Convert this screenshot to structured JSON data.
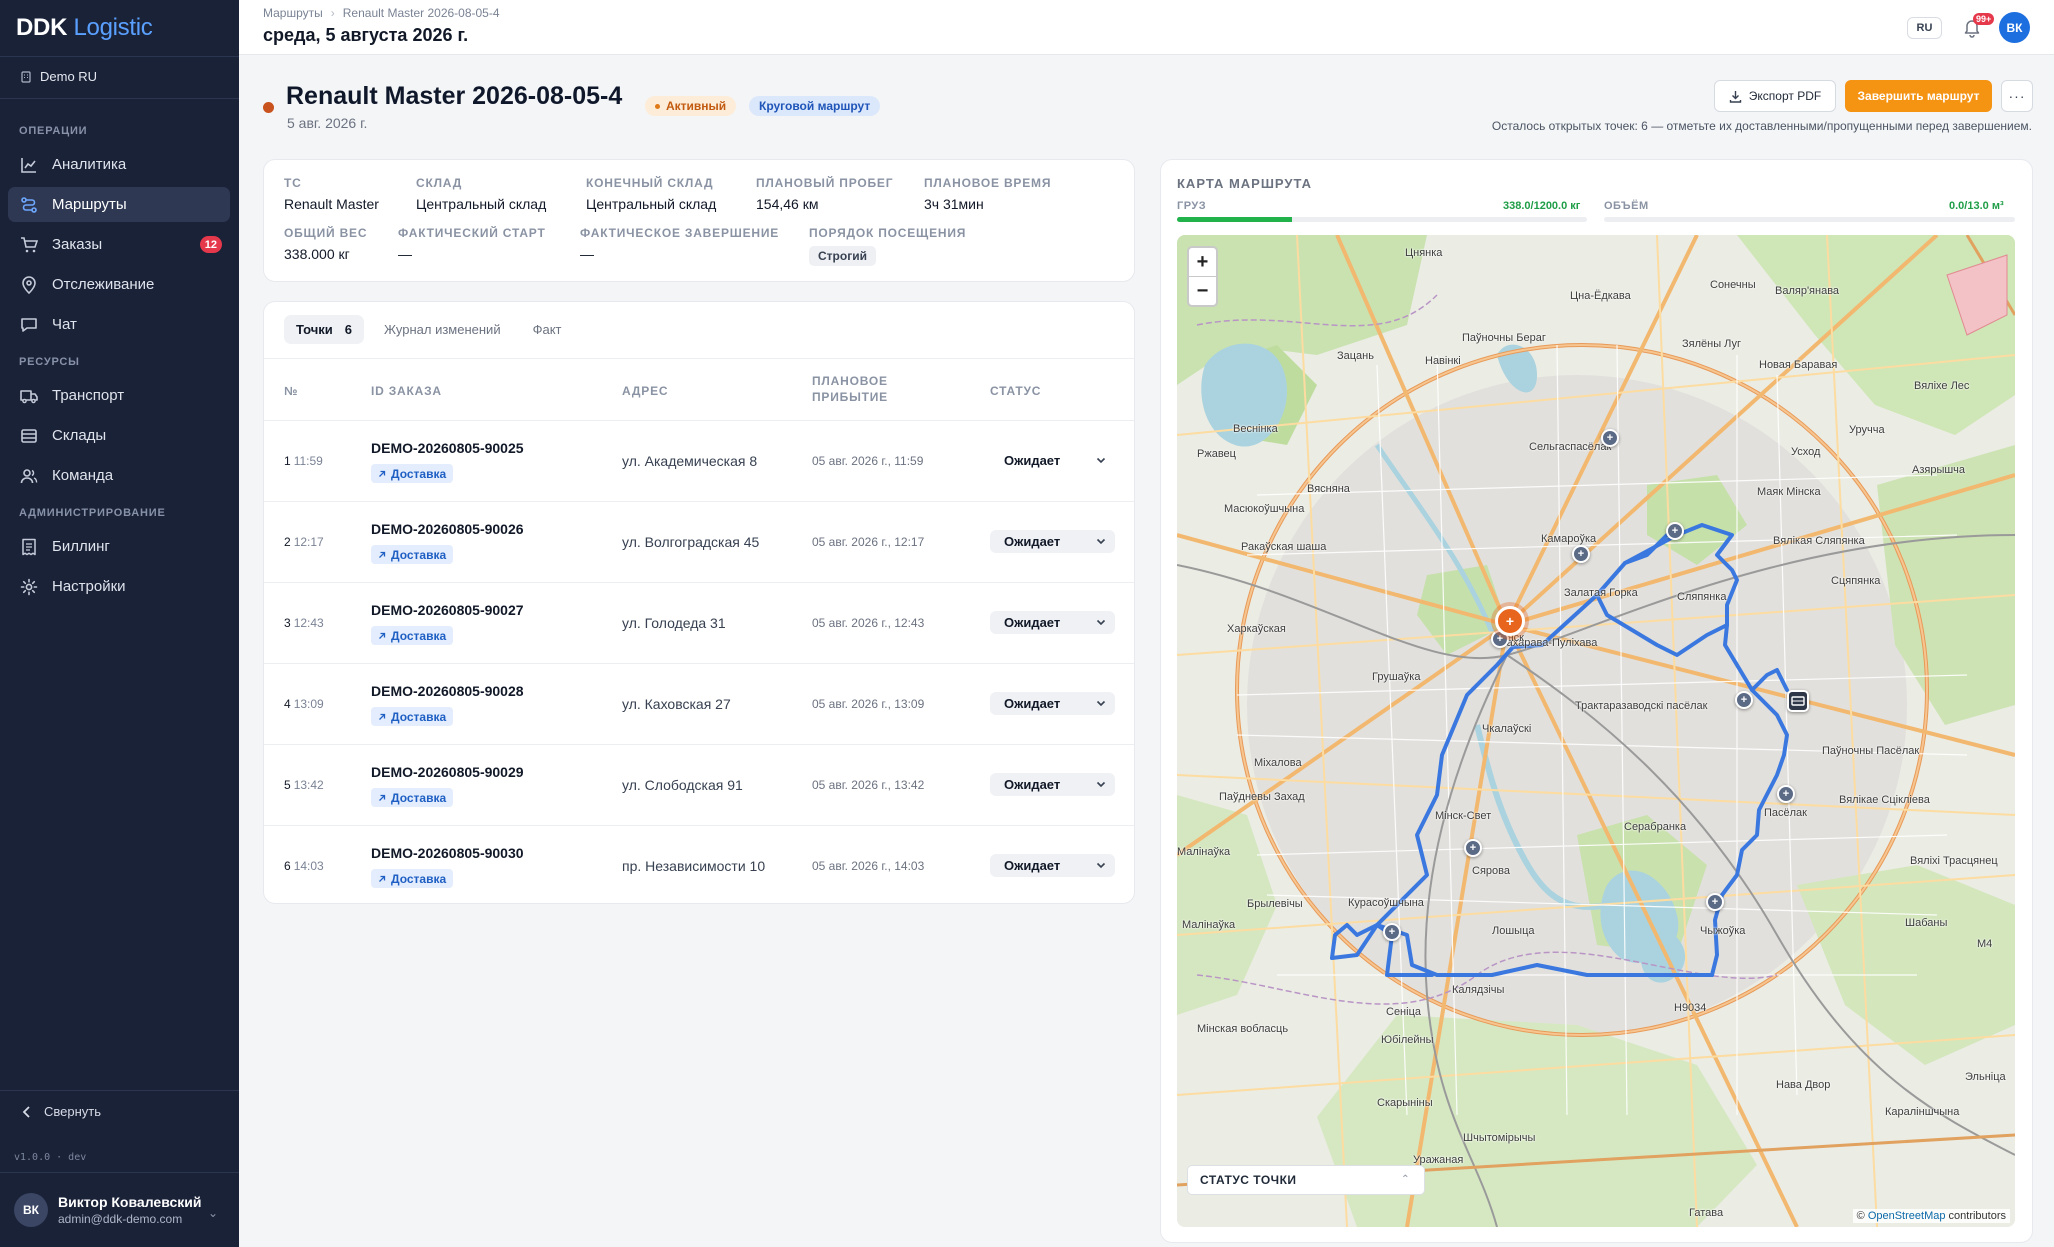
{
  "app": {
    "logo_part1": "DDK",
    "logo_part2": "Logistic",
    "org": "Demo RU"
  },
  "sidebar": {
    "sections": {
      "operations": "ОПЕРАЦИИ",
      "resources": "РЕСУРСЫ",
      "admin": "АДМИНИСТРИРОВАНИЕ"
    },
    "items": [
      {
        "label": "Аналитика",
        "icon": "chart-icon"
      },
      {
        "label": "Маршруты",
        "icon": "route-icon",
        "active": true
      },
      {
        "label": "Заказы",
        "icon": "cart-icon",
        "badge": "12"
      },
      {
        "label": "Отслеживание",
        "icon": "pin-icon"
      },
      {
        "label": "Чат",
        "icon": "chat-icon"
      },
      {
        "label": "Транспорт",
        "icon": "truck-icon"
      },
      {
        "label": "Склады",
        "icon": "warehouse-icon"
      },
      {
        "label": "Команда",
        "icon": "users-icon"
      },
      {
        "label": "Биллинг",
        "icon": "receipt-icon"
      },
      {
        "label": "Настройки",
        "icon": "gear-icon"
      }
    ],
    "collapse_label": "Свернуть",
    "version": "v1.0.0 · dev",
    "user": {
      "initials": "ВК",
      "name": "Виктор Ковалевский",
      "email": "admin@ddk-demo.com"
    }
  },
  "header": {
    "breadcrumb": [
      "Маршруты",
      "Renault Master 2026-08-05-4"
    ],
    "date": "среда, 5 августа 2026 г.",
    "lang": "RU",
    "notifications": "99+",
    "avatar": "ВК"
  },
  "route": {
    "title": "Renault Master 2026-08-05-4",
    "subtitle": "5 авг. 2026 г.",
    "status_pill": "Активный",
    "type_pill": "Круговой маршрут",
    "export_label": "Экспорт PDF",
    "finish_label": "Завершить маршрут",
    "more_label": "···",
    "remaining_note": "Осталось открытых точек: 6 — отметьте их доставленными/пропущенными перед завершением."
  },
  "info": {
    "vehicle_label": "ТС",
    "vehicle": "Renault Master",
    "warehouse_label": "СКЛАД",
    "warehouse": "Центральный склад",
    "end_warehouse_label": "КОНЕЧНЫЙ СКЛАД",
    "end_warehouse": "Центральный склад",
    "planned_distance_label": "ПЛАНОВЫЙ ПРОБЕГ",
    "planned_distance": "154,46 км",
    "planned_time_label": "ПЛАНОВОЕ ВРЕМЯ",
    "planned_time": "3ч 31мин",
    "total_weight_label": "ОБЩИЙ ВЕС",
    "total_weight": "338.000 кг",
    "actual_start_label": "ФАКТИЧЕСКИЙ СТАРТ",
    "actual_start": "—",
    "actual_end_label": "ФАКТИЧЕСКОЕ ЗАВЕРШЕНИЕ",
    "actual_end": "—",
    "visit_order_label": "ПОРЯДОК ПОСЕЩЕНИЯ",
    "visit_order": "Строгий"
  },
  "points": {
    "tabs": [
      {
        "label": "Точки",
        "count": "6"
      },
      {
        "label": "Журнал изменений"
      },
      {
        "label": "Факт"
      }
    ],
    "columns": {
      "num": "№",
      "order_id": "ID ЗАКАЗА",
      "address": "АДРЕС",
      "eta_1": "ПЛАНОВОЕ",
      "eta_2": "ПРИБЫТИЕ",
      "status": "СТАТУС"
    },
    "rows": [
      {
        "num": "1",
        "time": "11:59",
        "order_id": "DEMO-20260805-90025",
        "tag": "Доставка",
        "address": "ул. Академическая 8",
        "eta": "05 авг. 2026 г., 11:59",
        "status": "Ожидает"
      },
      {
        "num": "2",
        "time": "12:17",
        "order_id": "DEMO-20260805-90026",
        "tag": "Доставка",
        "address": "ул. Волгоградская 45",
        "eta": "05 авг. 2026 г., 12:17",
        "status": "Ожидает"
      },
      {
        "num": "3",
        "time": "12:43",
        "order_id": "DEMO-20260805-90027",
        "tag": "Доставка",
        "address": "ул. Голодеда 31",
        "eta": "05 авг. 2026 г., 12:43",
        "status": "Ожидает"
      },
      {
        "num": "4",
        "time": "13:09",
        "order_id": "DEMO-20260805-90028",
        "tag": "Доставка",
        "address": "ул. Каховская 27",
        "eta": "05 авг. 2026 г., 13:09",
        "status": "Ожидает"
      },
      {
        "num": "5",
        "time": "13:42",
        "order_id": "DEMO-20260805-90029",
        "tag": "Доставка",
        "address": "ул. Слободская 91",
        "eta": "05 авг. 2026 г., 13:42",
        "status": "Ожидает"
      },
      {
        "num": "6",
        "time": "14:03",
        "order_id": "DEMO-20260805-90030",
        "tag": "Доставка",
        "address": "пр. Независимости 10",
        "eta": "05 авг. 2026 г., 14:03",
        "status": "Ожидает"
      }
    ]
  },
  "map": {
    "title": "КАРТА МАРШРУТА",
    "cargo_label": "ГРУЗ",
    "cargo_value": "338.0/1200.0 кг",
    "cargo_fraction": 0.28,
    "volume_label": "ОБЪЁМ",
    "volume_value": "0.0/13.0 м³",
    "volume_fraction": 0.0,
    "zoom_in": "+",
    "zoom_out": "−",
    "legend_title": "СТАТУС ТОЧКИ",
    "attribution_prefix": "© ",
    "attribution_link": "OpenStreetMap",
    "attribution_suffix": " contributors",
    "route_color": "#3a78e0",
    "labels": {
      "l1": "Цна-Ёдкава",
      "l2": "Сонечны",
      "l3": "Валяр'янава",
      "l4": "Цнянка",
      "l5": "Паўночны Бераг",
      "l6": "Зацань",
      "l7": "Навінкі",
      "l8": "Зялёны Луг",
      "l9": "Новая Баравая",
      "l10": "Вяліхе Лес",
      "l11": "Веснінка",
      "l12": "Сельгаспасёлак",
      "l13": "Уручча",
      "l14": "Ржавец",
      "l15": "Усход",
      "l16": "Азярышча",
      "l17": "Вясняна",
      "l18": "Маяк Мінска",
      "l19": "Масюкоўшчына",
      "l20": "Камароўка",
      "l21": "Вялікая Сляпянка",
      "l22": "Сляпянка",
      "l23": "Ракаўская шаша",
      "l24": "Залатая Горка",
      "l25": "Сцяпянка",
      "l26": "Харкаўская",
      "l27": "Захарава-Пуліхава",
      "l28": "Трактаразаводскі пасёлак",
      "l29": "Грушаўка",
      "l30": "Чкалаўскі",
      "l31": "Паўночны Пасёлак",
      "l32": "Міхалова",
      "l33": "Паўдневы Захад",
      "l34": "Мінск-Свет",
      "l35": "Серабранка",
      "l36": "Пасёлак",
      "l37": "Вялікае Сцікліева",
      "l38": "Малінаўка",
      "l39": "Сярова",
      "l40": "Вяліхі Трасцянец",
      "l41": "Курасоўшчына",
      "l42": "Брылевічы",
      "l43": "Лошыца",
      "l44": "Чыжоўка",
      "l45": "Шабаны",
      "l46": "Малінаўка",
      "l47": "Калядзічы",
      "l48": "Сеніца",
      "l49": "Юбілейны",
      "l50": "Скарыніны",
      "l51": "Шчытомірычы",
      "l52": "Уражаная",
      "l53": "Гатава",
      "l54": "Нава Двор",
      "l55": "Караліншчына",
      "l56": "Эльніца",
      "l57": "H9034",
      "l58": "M4",
      "l59": "Мінск",
      "l60": "Мінская вобласць"
    }
  }
}
